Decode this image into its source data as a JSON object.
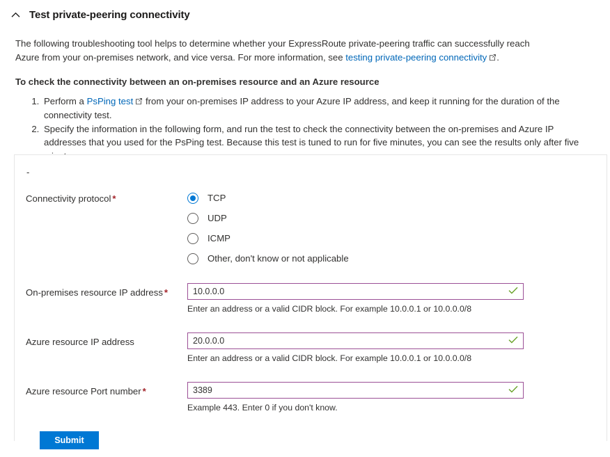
{
  "header": {
    "collapse_icon": "chevron-up-icon",
    "title": "Test private-peering connectivity"
  },
  "intro": {
    "paragraph_part1": "The following troubleshooting tool helps to determine whether your ExpressRoute private-peering traffic can successfully reach Azure from your on-premises network, and vice versa. For more information, see ",
    "link_text": "testing private-peering connectivity",
    "link_icon": "external-link-icon",
    "paragraph_part2": ".",
    "bold_heading": "To check the connectivity between an on-premises resource and an Azure resource",
    "steps": [
      {
        "before_link": "Perform a ",
        "link_text": "PsPing test",
        "link_icon": "external-link-icon",
        "after_link": " from your on-premises IP address to your Azure IP address, and keep it running for the duration of the connectivity test."
      },
      {
        "before_link": "Specify the information in the following form, and run the test to check the connectivity between the on-premises and Azure IP addresses that you used for the PsPing test. Because this test is tuned to run for five minutes, you can see the results only after five minutes.",
        "link_text": "",
        "link_icon": "",
        "after_link": ""
      }
    ]
  },
  "form": {
    "dash_note": "-",
    "protocol": {
      "label": "Connectivity protocol",
      "required_marker": "*",
      "selected": "TCP",
      "options": [
        {
          "label": "TCP",
          "selected": true
        },
        {
          "label": "UDP",
          "selected": false
        },
        {
          "label": "ICMP",
          "selected": false
        },
        {
          "label": "Other, don't know or not applicable",
          "selected": false
        }
      ]
    },
    "fields": [
      {
        "label": "On-premises resource IP address",
        "required_marker": "*",
        "value": "10.0.0.0",
        "placeholder": "",
        "helper": "Enter an address or a valid CIDR block. For example 10.0.0.1 or 10.0.0.0/8",
        "valid_icon": "checkmark-icon"
      },
      {
        "label": "Azure resource IP address",
        "required_marker": "",
        "value": "20.0.0.0",
        "placeholder": "",
        "helper": "Enter an address or a valid CIDR block. For example 10.0.0.1 or 10.0.0.0/8",
        "valid_icon": "checkmark-icon"
      },
      {
        "label": "Azure resource Port number",
        "required_marker": "*",
        "value": "3389",
        "placeholder": "",
        "helper": "Example 443. Enter 0 if you don't know.",
        "valid_icon": "checkmark-icon"
      }
    ],
    "submit_label": "Submit"
  },
  "colors": {
    "accent_blue": "#0078d4",
    "link_blue": "#0067b8",
    "input_border_purple": "#9b4f96",
    "valid_green": "#69a22a",
    "required_red": "#a4262c",
    "card_border": "#e6e6e6"
  }
}
